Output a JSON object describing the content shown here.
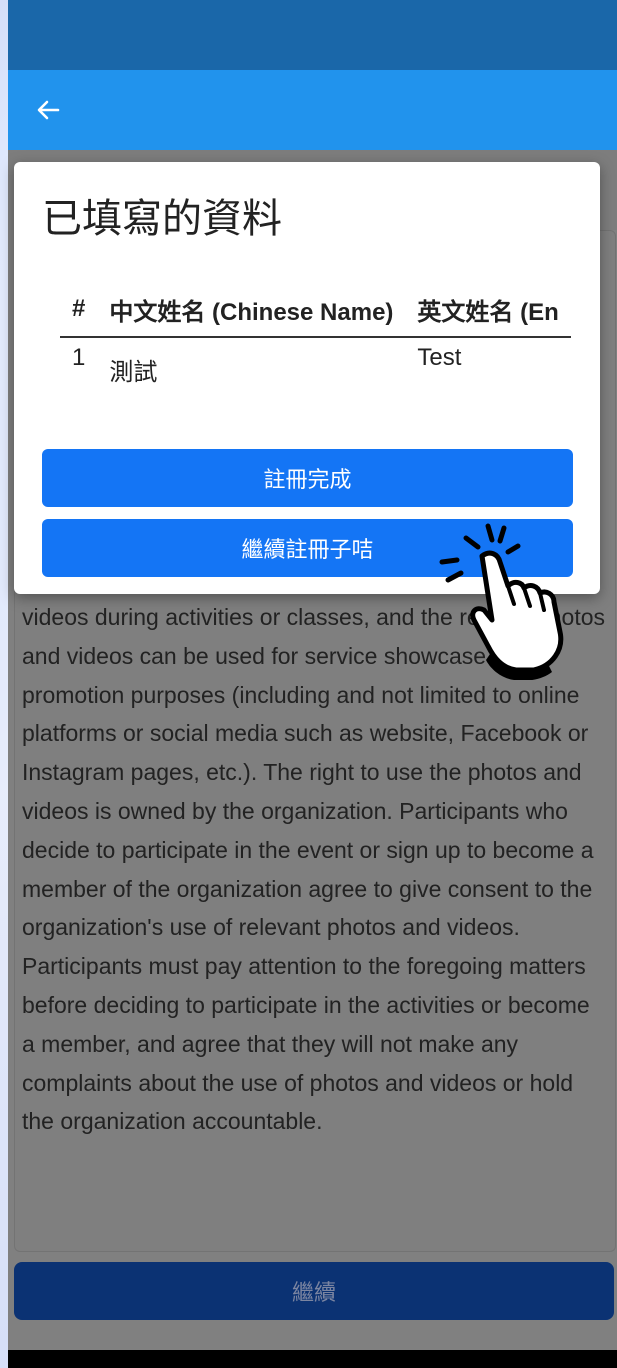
{
  "app_bar": {
    "back_icon": "arrow-left-icon"
  },
  "modal": {
    "title": "已填寫的資料",
    "table": {
      "headers": [
        "#",
        "中文姓名 (Chinese Name)",
        "英文姓名 (En"
      ],
      "rows": [
        [
          "1",
          "測試",
          "Test"
        ]
      ]
    },
    "register_done_label": "註冊完成",
    "continue_child_label": "繼續註冊子咭"
  },
  "body_text": "videos during activities or classes, and the related photos and videos can be used for service showcase or promotion purposes (including and not limited to online platforms or social media such as website, Facebook or Instagram pages, etc.). The right to use the photos and videos is owned by the organization. Participants who decide to participate in the event or sign up to become a member of the organization agree to give consent to the organization's use of relevant photos and videos. Participants must pay attention to the foregoing matters before deciding to participate in the activities or become a member, and agree that they will not make any complaints about the use of photos and videos or hold the organization accountable.",
  "continue_label": "繼續",
  "overlay": {
    "pointer_icon": "hand-pointer-icon"
  }
}
